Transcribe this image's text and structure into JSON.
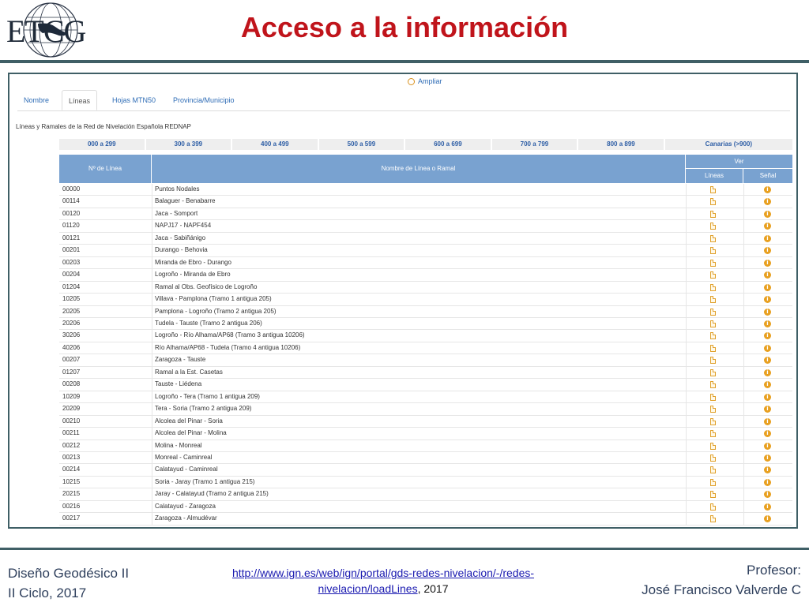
{
  "header": {
    "logo_text": "ETCG",
    "title": "Acceso a la información"
  },
  "screenshot": {
    "ampliar_label": "Ampliar",
    "tabs": [
      {
        "label": "Nombre"
      },
      {
        "label": "Líneas",
        "active": true
      },
      {
        "label": "Hojas MTN50"
      },
      {
        "label": "Provincia/Municipio"
      }
    ],
    "subtitle": "Líneas y Ramales de la Red de Nivelación Española REDNAP",
    "ranges": [
      "000 a 299",
      "300 a 399",
      "400 a 499",
      "500 a 599",
      "600 a 699",
      "700 a 799",
      "800 a 899",
      "Canarias (>900)"
    ],
    "table": {
      "col_num": "Nº de Línea",
      "col_name": "Nombre de Línea o Ramal",
      "col_ver": "Ver",
      "col_lineas": "Líneas",
      "col_senal": "Señal",
      "rows": [
        {
          "num": "00000",
          "name": "Puntos Nodales"
        },
        {
          "num": "00114",
          "name": "Balaguer - Benabarre"
        },
        {
          "num": "00120",
          "name": "Jaca - Somport"
        },
        {
          "num": "01120",
          "name": "NAPJ17 - NAPF454"
        },
        {
          "num": "00121",
          "name": "Jaca - Sabiñánigo"
        },
        {
          "num": "00201",
          "name": "Durango - Behovia"
        },
        {
          "num": "00203",
          "name": "Miranda de Ebro - Durango"
        },
        {
          "num": "00204",
          "name": "Logroño - Miranda de Ebro"
        },
        {
          "num": "01204",
          "name": "Ramal al Obs. Geofísico de Logroño"
        },
        {
          "num": "10205",
          "name": "Villava - Pamplona (Tramo 1 antigua 205)"
        },
        {
          "num": "20205",
          "name": "Pamplona - Logroño (Tramo 2 antigua 205)"
        },
        {
          "num": "20206",
          "name": "Tudela - Tauste (Tramo 2 antigua 206)"
        },
        {
          "num": "30206",
          "name": "Logroño - Río Alhama/AP68 (Tramo 3 antigua 10206)"
        },
        {
          "num": "40206",
          "name": "Río Alhama/AP68 - Tudela (Tramo 4 antigua 10206)"
        },
        {
          "num": "00207",
          "name": "Zaragoza - Tauste"
        },
        {
          "num": "01207",
          "name": "Ramal a la Est. Casetas"
        },
        {
          "num": "00208",
          "name": "Tauste - Liédena"
        },
        {
          "num": "10209",
          "name": "Logroño - Tera (Tramo 1 antigua 209)"
        },
        {
          "num": "20209",
          "name": "Tera - Soria (Tramo 2 antigua 209)"
        },
        {
          "num": "00210",
          "name": "Alcolea del Pinar - Soria"
        },
        {
          "num": "00211",
          "name": "Alcolea del Pinar - Molina"
        },
        {
          "num": "00212",
          "name": "Molina - Monreal"
        },
        {
          "num": "00213",
          "name": "Monreal - Caminreal"
        },
        {
          "num": "00214",
          "name": "Calatayud - Caminreal"
        },
        {
          "num": "10215",
          "name": "Soria - Jaray (Tramo 1 antigua 215)"
        },
        {
          "num": "20215",
          "name": "Jaray - Calatayud (Tramo 2 antigua 215)"
        },
        {
          "num": "00216",
          "name": "Calatayud - Zaragoza"
        },
        {
          "num": "00217",
          "name": "Zaragoza - Almudévar"
        }
      ]
    }
  },
  "footer": {
    "left_line1": "Diseño Geodésico II",
    "left_line2": "II Ciclo, 2017",
    "link_line1": "http://www.ign.es/web/ign/portal/gds-redes-nivelacion/-/redes-",
    "link_line2": "nivelacion/loadLines",
    "year_suffix": ", 2017",
    "right_line1": "Profesor:",
    "right_line2": "José Francisco Valverde C"
  },
  "colors": {
    "title": "#c0141b",
    "rule": "#3f5f66",
    "table_header": "#79a2d0",
    "link": "#2f6db6",
    "icon": "#e8a020"
  }
}
